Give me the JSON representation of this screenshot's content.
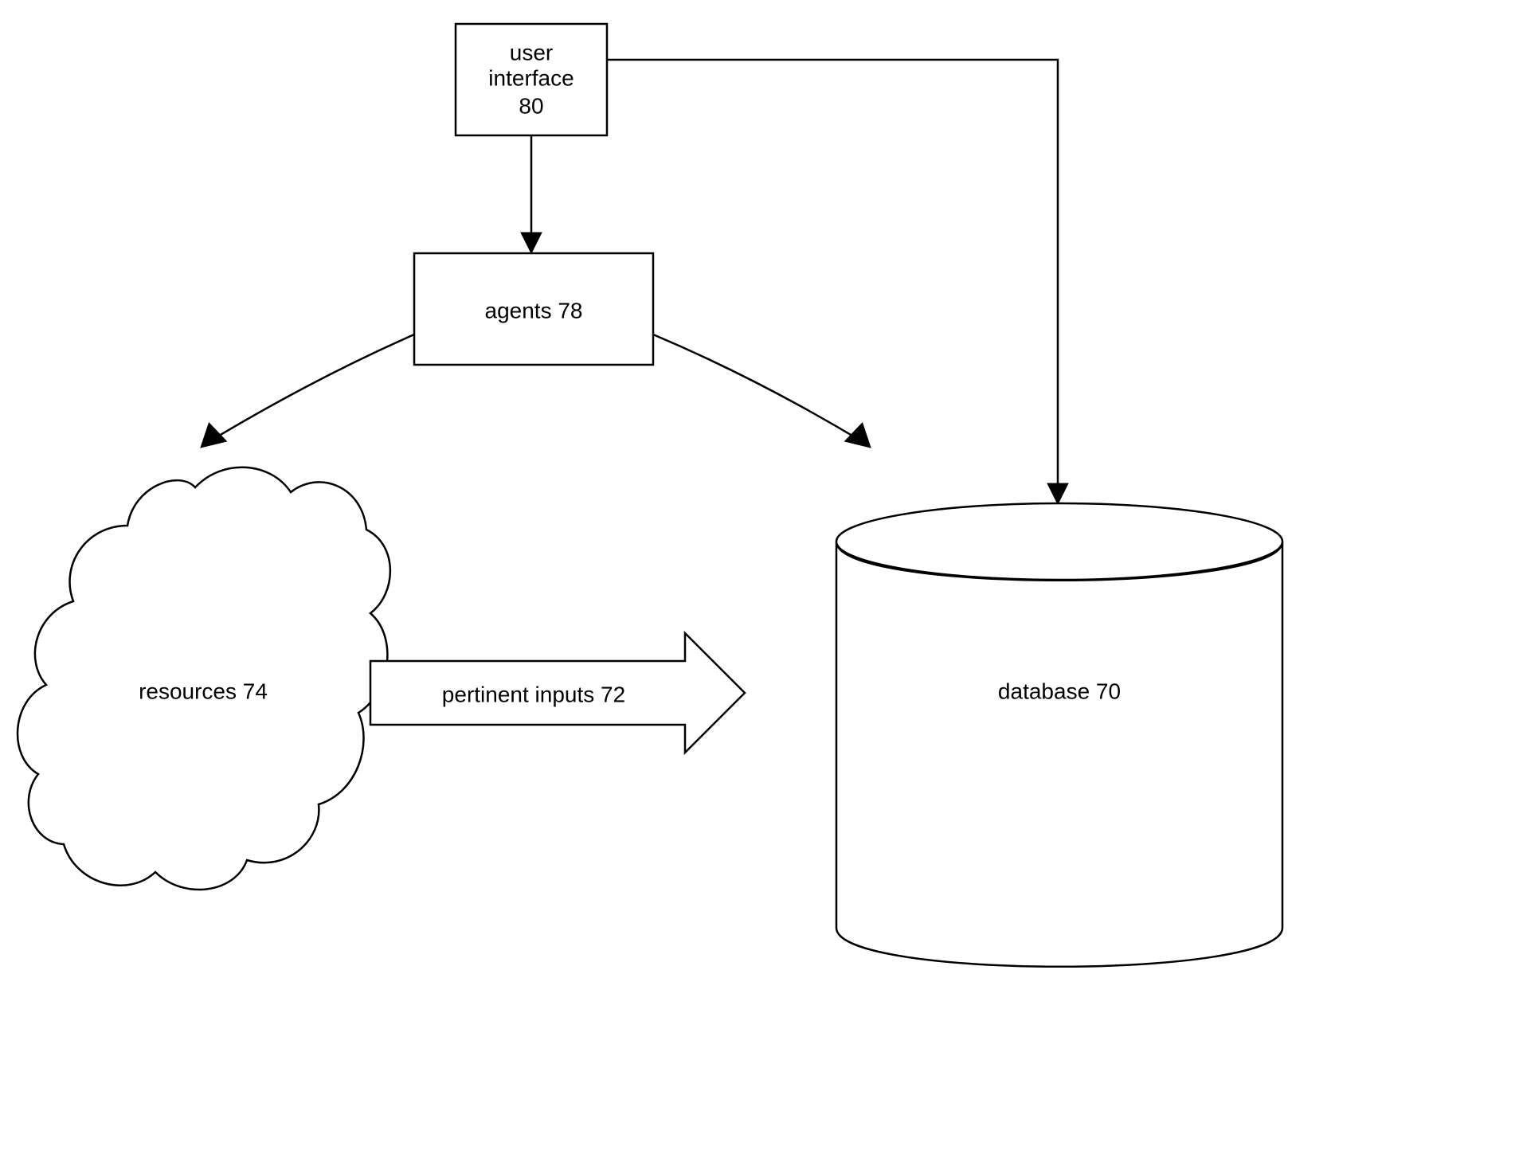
{
  "nodes": {
    "user_interface": {
      "label_line1": "user",
      "label_line2": "interface",
      "number": "80"
    },
    "agents": {
      "label": "agents 78"
    },
    "resources": {
      "label": "resources 74"
    },
    "database": {
      "label": "database 70"
    },
    "connector_arrow": {
      "label": "pertinent inputs 72"
    }
  }
}
